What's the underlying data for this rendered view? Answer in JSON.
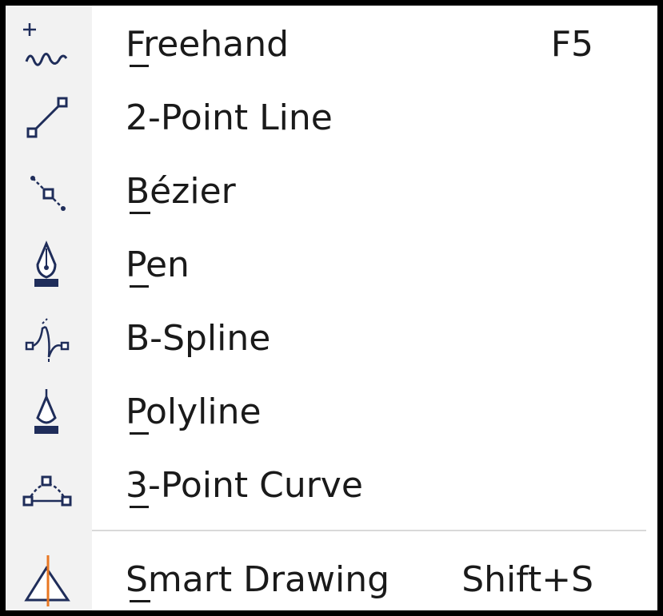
{
  "menu": {
    "items": [
      {
        "label": "Freehand",
        "mnemonic": "F",
        "shortcut": "F5",
        "icon": "freehand-icon"
      },
      {
        "label": "2-Point Line",
        "mnemonic": "",
        "shortcut": "",
        "icon": "two-point-line-icon"
      },
      {
        "label": "Bézier",
        "mnemonic": "B",
        "shortcut": "",
        "icon": "bezier-icon"
      },
      {
        "label": "Pen",
        "mnemonic": "P",
        "shortcut": "",
        "icon": "pen-icon"
      },
      {
        "label": "B-Spline",
        "mnemonic": "",
        "shortcut": "",
        "icon": "b-spline-icon"
      },
      {
        "label": "Polyline",
        "mnemonic": "P",
        "shortcut": "",
        "icon": "polyline-icon"
      },
      {
        "label": "3-Point Curve",
        "mnemonic": "3",
        "shortcut": "",
        "icon": "three-point-curve-icon"
      },
      {
        "label": "Smart Drawing",
        "mnemonic": "S",
        "shortcut": "Shift+S",
        "icon": "smart-drawing-icon"
      }
    ]
  },
  "colors": {
    "border": "#000000",
    "icon_navy": "#1f2d5a",
    "accent_orange": "#e87722",
    "gutter": "#f2f2f2",
    "divider": "#d9d9d9"
  }
}
